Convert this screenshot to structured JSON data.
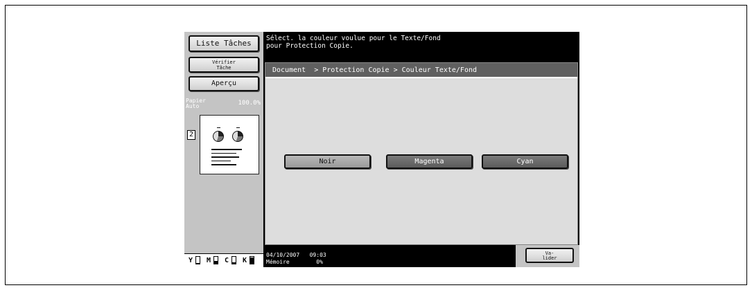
{
  "left_panel": {
    "job_list_label": "Liste Tâches",
    "check_job_label": "Vérifier\nTâche",
    "preview_label": "Aperçu",
    "paper_label": "Papier\nAuto",
    "zoom": "100.0%",
    "page_indicator": "2"
  },
  "toner": [
    {
      "label": "Y",
      "level": 0.15
    },
    {
      "label": "M",
      "level": 0.45
    },
    {
      "label": "C",
      "level": 0.25
    },
    {
      "label": "K",
      "level": 0.9
    }
  ],
  "message": "Sélect. la couleur voulue pour le Texte/Fond\npour Protection Copie.",
  "breadcrumb": "Document  > Protection Copie > Couleur Texte/Fond",
  "choices": {
    "black": "Noir",
    "magenta": "Magenta",
    "cyan": "Cyan"
  },
  "status": {
    "datetime": "04/10/2007   09:03",
    "memory": "Mémoire        0%"
  },
  "ok_label": "Va-\nlider"
}
